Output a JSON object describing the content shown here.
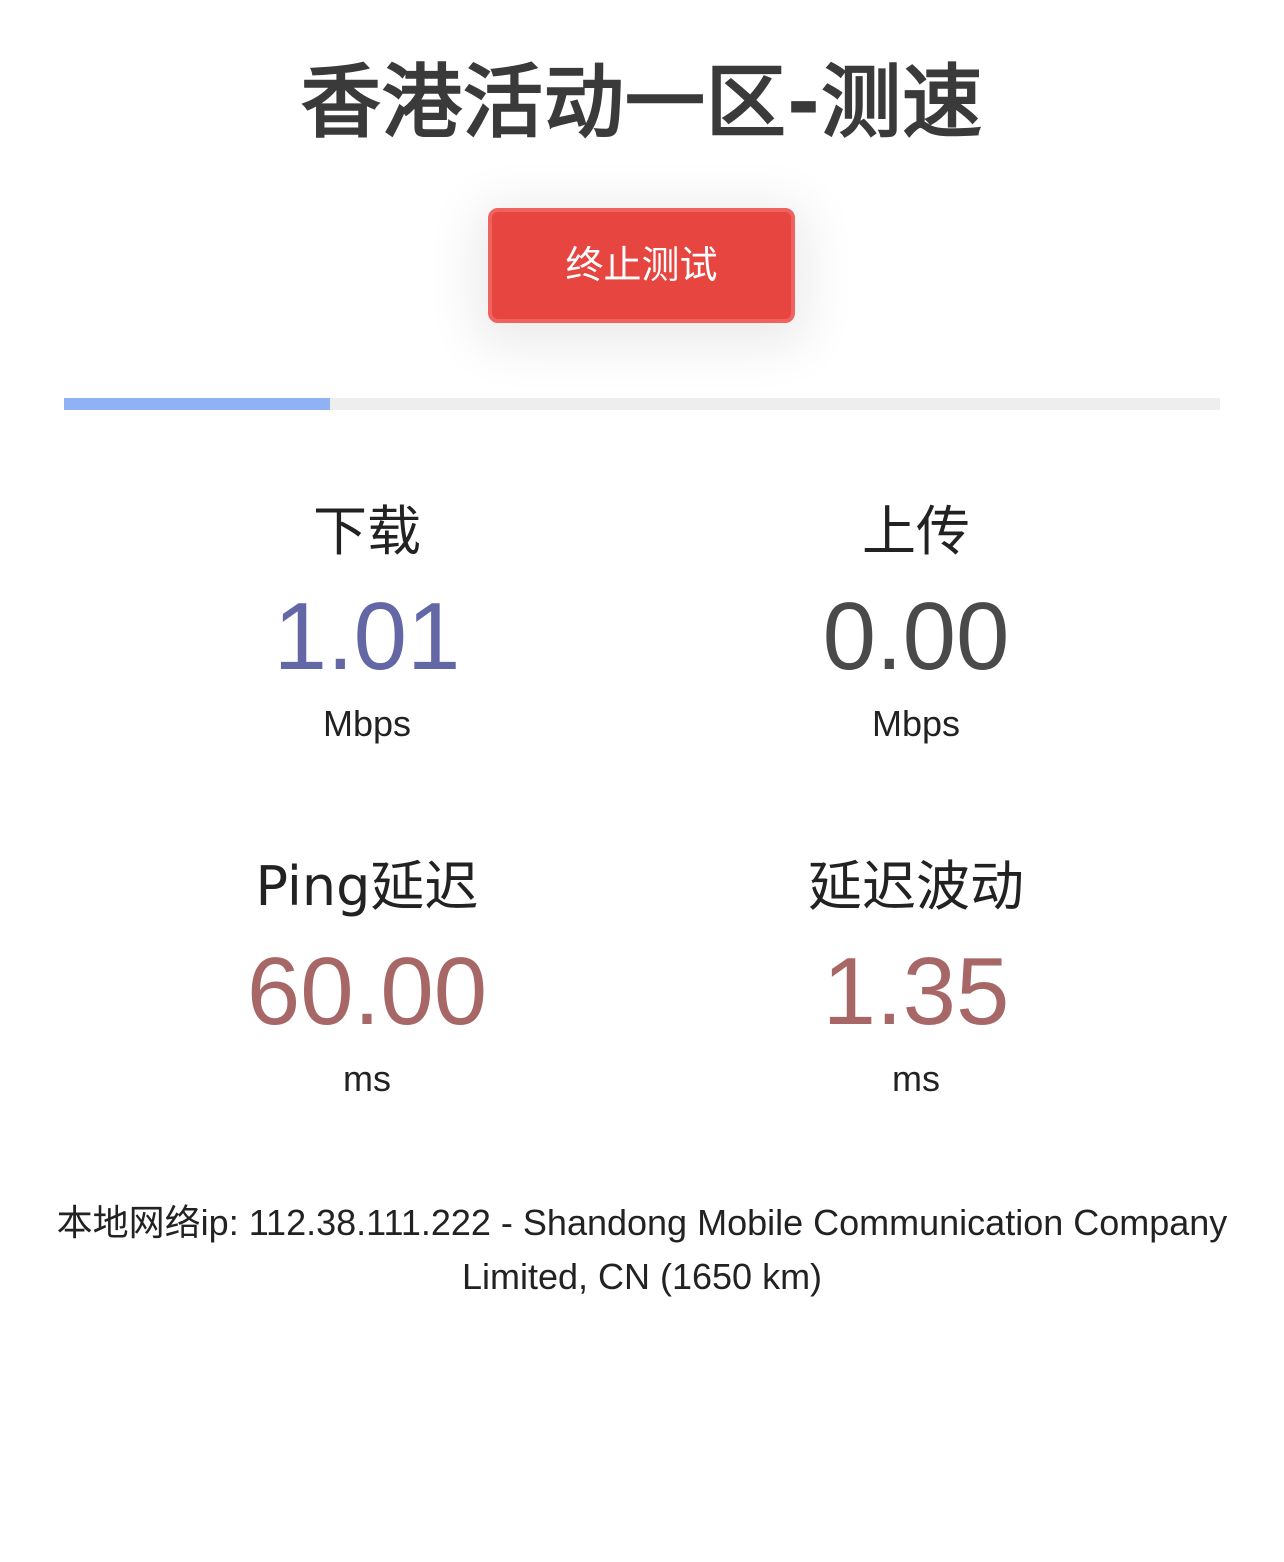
{
  "title": "香港活动一区-测速",
  "stop_button_label": "终止测试",
  "progress": {
    "fraction": 0.23,
    "fill_color": "#8eb2f3"
  },
  "stats": {
    "download": {
      "label": "下载",
      "value": "1.01",
      "unit": "Mbps",
      "color": "#6367a5"
    },
    "upload": {
      "label": "上传",
      "value": "0.00",
      "unit": "Mbps",
      "color": "#4a4a4a"
    },
    "ping": {
      "label": "Ping延迟",
      "value": "60.00",
      "unit": "ms",
      "color": "#a76766"
    },
    "jitter": {
      "label": "延迟波动",
      "value": "1.35",
      "unit": "ms",
      "color": "#a76766"
    }
  },
  "ip_info": {
    "line1": "本地网络ip: 112.38.111.222 - Shandong Mobile Communication Company",
    "line2": "Limited, CN (1650 km)"
  }
}
